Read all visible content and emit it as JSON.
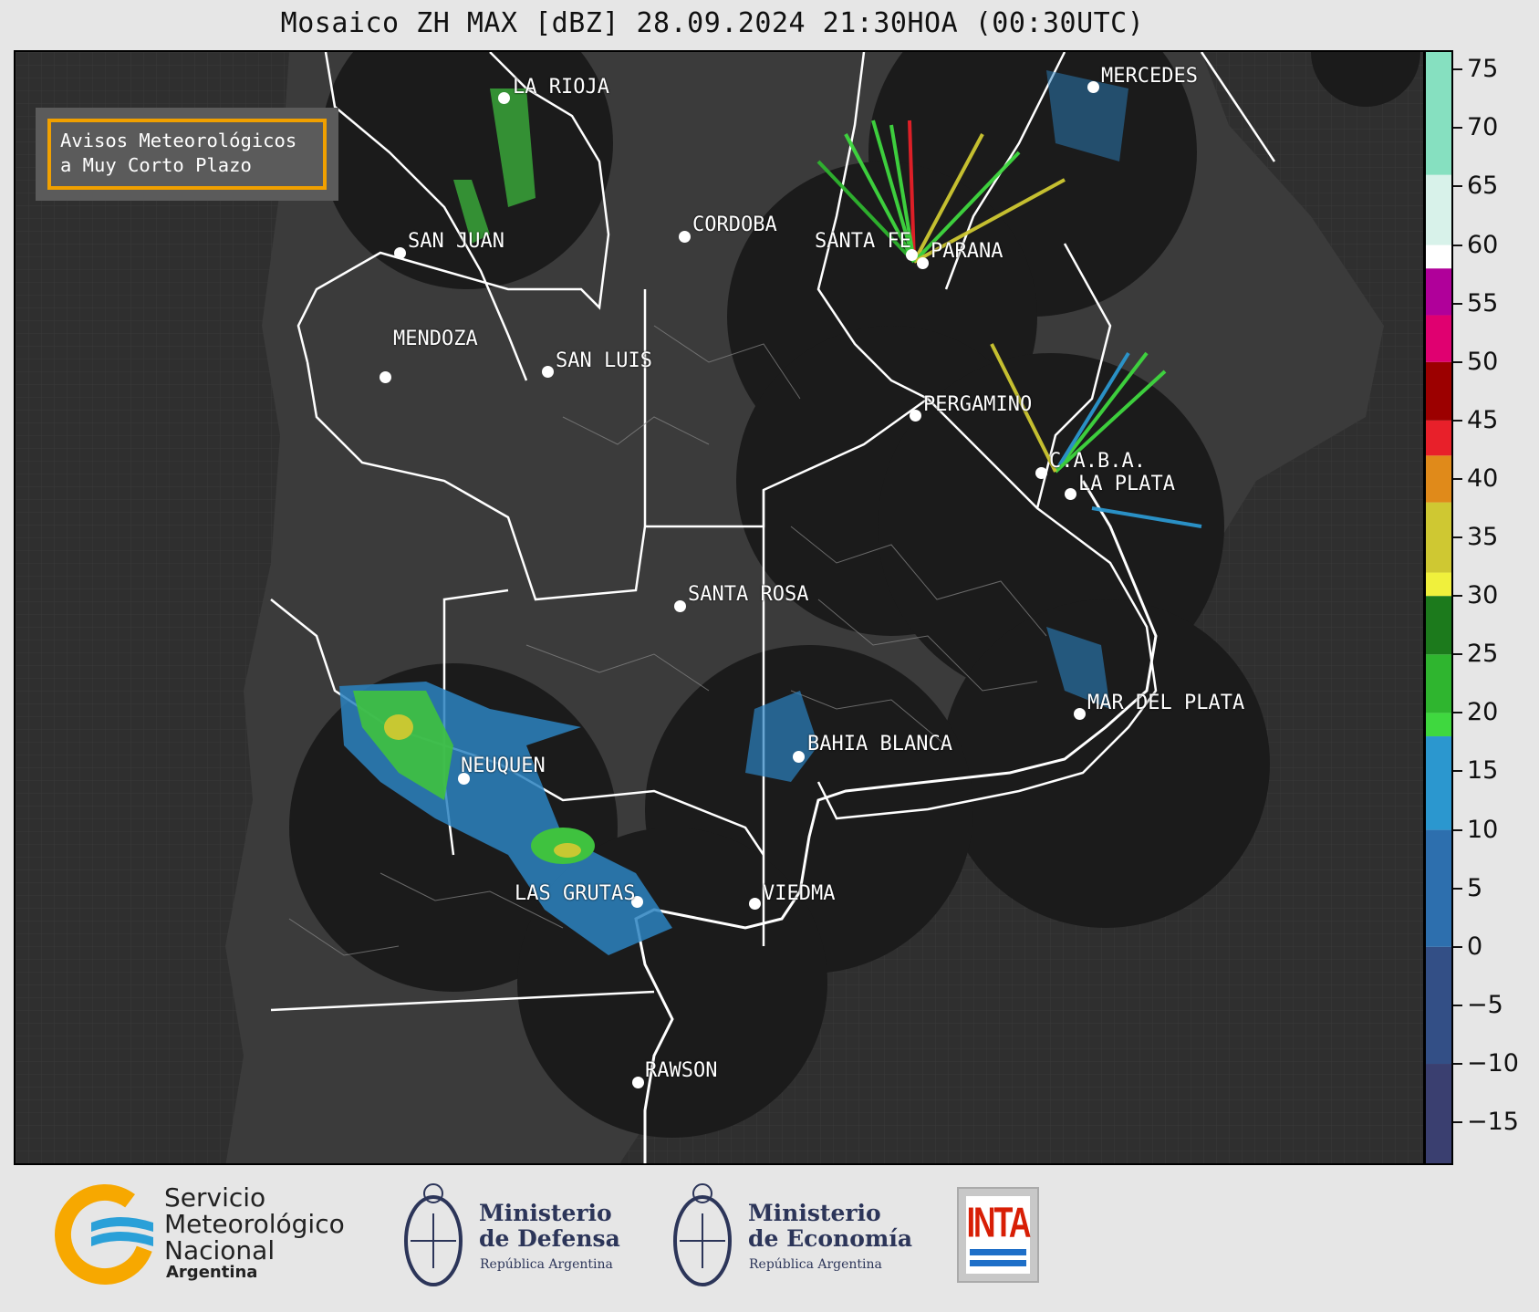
{
  "title": "Mosaico ZH MAX [dBZ] 28.09.2024 21:30HOA (00:30UTC)",
  "badge": {
    "line1": "Avisos Meteorológicos",
    "line2": "a Muy Corto Plazo",
    "border_color": "#f0a000"
  },
  "cities": [
    {
      "name": "LA RIOJA"
    },
    {
      "name": "MERCEDES"
    },
    {
      "name": "CORDOBA"
    },
    {
      "name": "SAN JUAN"
    },
    {
      "name": "SANTA FE"
    },
    {
      "name": "PARANA"
    },
    {
      "name": "MENDOZA"
    },
    {
      "name": "SAN LUIS"
    },
    {
      "name": "PERGAMINO"
    },
    {
      "name": "C.A.B.A."
    },
    {
      "name": "LA PLATA"
    },
    {
      "name": "SANTA ROSA"
    },
    {
      "name": "MAR DEL PLATA"
    },
    {
      "name": "BAHIA BLANCA"
    },
    {
      "name": "NEUQUEN"
    },
    {
      "name": "LAS GRUTAS"
    },
    {
      "name": "VIEDMA"
    },
    {
      "name": "RAWSON"
    }
  ],
  "colorbar": {
    "unit": "dBZ",
    "min": -18.5,
    "max": 76.5,
    "ticks": [
      "75",
      "70",
      "65",
      "60",
      "55",
      "50",
      "45",
      "40",
      "35",
      "30",
      "25",
      "20",
      "15",
      "10",
      "5",
      "0",
      "−5",
      "−10",
      "−15"
    ],
    "tick_values": [
      75,
      70,
      65,
      60,
      55,
      50,
      45,
      40,
      35,
      30,
      25,
      20,
      15,
      10,
      5,
      0,
      -5,
      -10,
      -15
    ],
    "bands": [
      {
        "from": -18.5,
        "to": -10,
        "color": "#3a3f70"
      },
      {
        "from": -10,
        "to": 0,
        "color": "#334f86"
      },
      {
        "from": 0,
        "to": 10,
        "color": "#2d6fae"
      },
      {
        "from": 10,
        "to": 18,
        "color": "#2b97cf"
      },
      {
        "from": 18,
        "to": 20,
        "color": "#3fd83f"
      },
      {
        "from": 20,
        "to": 25,
        "color": "#2fb52f"
      },
      {
        "from": 25,
        "to": 30,
        "color": "#1c7a1c"
      },
      {
        "from": 30,
        "to": 32,
        "color": "#f0f03c"
      },
      {
        "from": 32,
        "to": 38,
        "color": "#cfc832"
      },
      {
        "from": 38,
        "to": 42,
        "color": "#e08a1a"
      },
      {
        "from": 42,
        "to": 45,
        "color": "#e8202a"
      },
      {
        "from": 45,
        "to": 50,
        "color": "#9c0000"
      },
      {
        "from": 50,
        "to": 54,
        "color": "#e00070"
      },
      {
        "from": 54,
        "to": 58,
        "color": "#b0009a"
      },
      {
        "from": 58,
        "to": 60,
        "color": "#ffffff"
      },
      {
        "from": 60,
        "to": 66,
        "color": "#d8f2ea"
      },
      {
        "from": 66,
        "to": 76.5,
        "color": "#86e0c0"
      }
    ]
  },
  "logos": {
    "smn": {
      "name_lines": [
        "Servicio",
        "Meteorológico",
        "Nacional"
      ],
      "country": "Argentina"
    },
    "defensa": {
      "line1": "Ministerio",
      "line2": "de Defensa",
      "sub": "República Argentina"
    },
    "economia": {
      "line1": "Ministerio",
      "line2": "de Economía",
      "sub": "República Argentina"
    },
    "inta": {
      "text": "INTA"
    }
  },
  "colors": {
    "map_bg": "#2f2f2f",
    "radar_disk": "#1b1b1b",
    "border": "#ffffff"
  }
}
